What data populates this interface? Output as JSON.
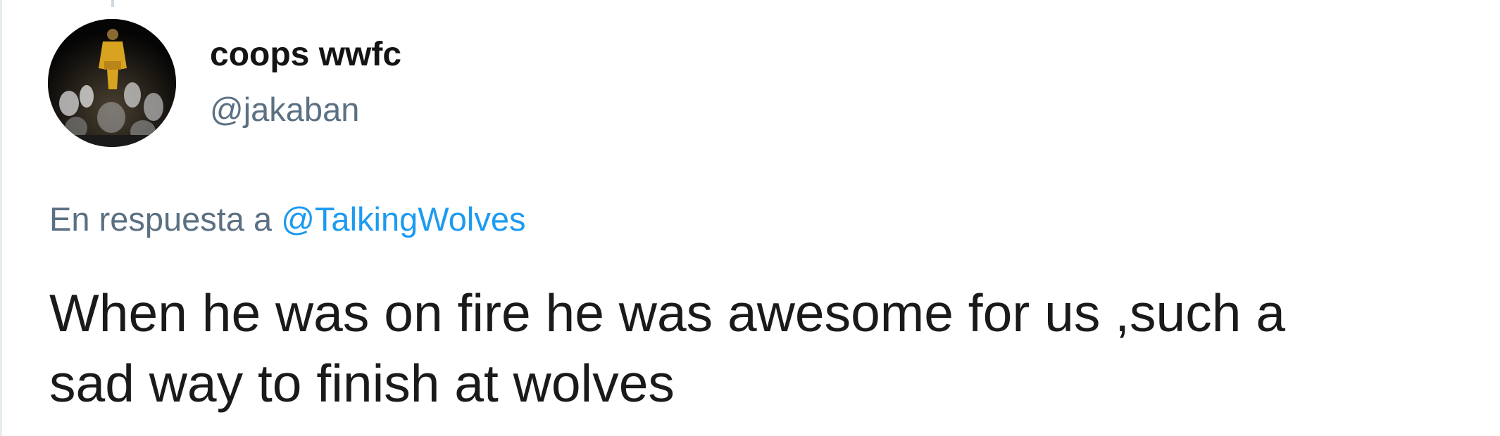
{
  "tweet": {
    "author": {
      "display_name": "coops wwfc",
      "handle": "@jakaban",
      "avatar_icon": "avatar-photo"
    },
    "reply_context": {
      "prefix": "En respuesta a",
      "target": "@TalkingWolves"
    },
    "text": "When he was on fire he was awesome for us ,such a\nsad way to finish at wolves"
  },
  "colors": {
    "link": "#1d9bf0",
    "secondary_text": "#5b7083",
    "primary_text": "#1a1a1a"
  }
}
